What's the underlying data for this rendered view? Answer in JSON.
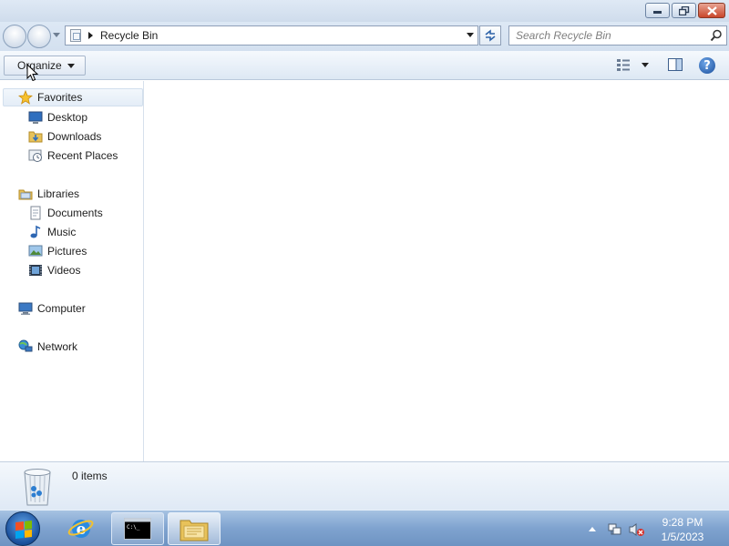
{
  "window": {
    "minimize_icon": "minimize-icon",
    "restore_icon": "restore-icon",
    "close_icon": "close-icon"
  },
  "address": {
    "location": "Recycle Bin",
    "search_placeholder": "Search Recycle Bin",
    "search_value": ""
  },
  "toolbar": {
    "organize_label": "Organize",
    "views_icon": "change-view-icon",
    "preview_icon": "preview-pane-icon",
    "help_label": "?"
  },
  "nav": {
    "favorites": {
      "label": "Favorites",
      "items": [
        {
          "label": "Desktop",
          "icon": "desktop-icon"
        },
        {
          "label": "Downloads",
          "icon": "downloads-icon"
        },
        {
          "label": "Recent Places",
          "icon": "recent-places-icon"
        }
      ]
    },
    "libraries": {
      "label": "Libraries",
      "items": [
        {
          "label": "Documents",
          "icon": "documents-icon"
        },
        {
          "label": "Music",
          "icon": "music-icon"
        },
        {
          "label": "Pictures",
          "icon": "pictures-icon"
        },
        {
          "label": "Videos",
          "icon": "videos-icon"
        }
      ]
    },
    "computer": {
      "label": "Computer",
      "icon": "computer-icon"
    },
    "network": {
      "label": "Network",
      "icon": "network-icon"
    }
  },
  "details": {
    "item_count": "0 items",
    "icon": "recycle-bin-icon"
  },
  "taskbar": {
    "start_icon": "windows-start-icon",
    "pinned": [
      {
        "name": "Internet Explorer",
        "icon": "internet-explorer-icon"
      },
      {
        "name": "Command Prompt",
        "icon": "command-prompt-icon"
      },
      {
        "name": "Windows Explorer",
        "icon": "windows-explorer-icon"
      }
    ],
    "clock_time": "9:28 PM",
    "clock_date": "1/5/2023"
  },
  "colors": {
    "titlebar": "#dfe9f5",
    "taskbar": "#7fa3cf",
    "close_button": "#c9462a",
    "selection": "#e4edf7"
  }
}
